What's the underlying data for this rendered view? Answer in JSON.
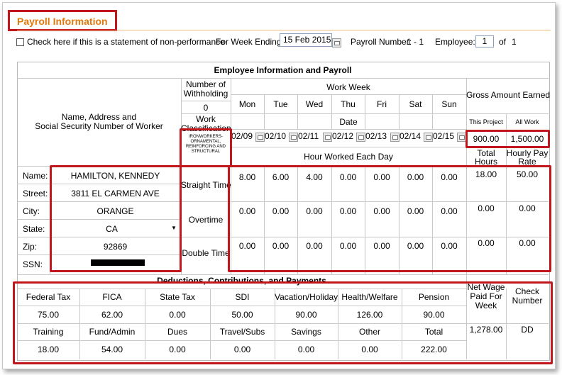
{
  "panel": {
    "title": "Payroll Information"
  },
  "topbar": {
    "non_performance_label": "Check here if this is a statement of non-performance",
    "week_ending_label": "For Week Ending:",
    "week_ending_value": "15 Feb 2015",
    "payroll_number_label": "Payroll Number:",
    "payroll_number_value": "1 - 1",
    "employee_label": "Employee:",
    "employee_value": "1",
    "employee_of": "of",
    "employee_total": "1"
  },
  "section_title": "Employee Information and Payroll",
  "headers": {
    "name_address_line1": "Name, Address and",
    "name_address_line2": "Social Security Number of Worker",
    "withholding_line1": "Number of",
    "withholding_line2": "Withholding",
    "withholding_value": "0",
    "classification_line1": "Work",
    "classification_line2": "Classification",
    "classification_value_1": "IRONWORKERS-",
    "classification_value_2": "ORNAMENTAL,",
    "classification_value_3": "REINFORCING AND",
    "classification_value_4": "STRUCTURAL",
    "work_week": "Work Week",
    "date": "Date",
    "hours_each_day": "Hour Worked Each Day",
    "gross_amount": "Gross Amount Earned",
    "this_project": "This Project",
    "all_work": "All Work",
    "total_hours_1": "Total",
    "total_hours_2": "Hours",
    "hourly_rate_1": "Hourly Pay",
    "hourly_rate_2": "Rate"
  },
  "days": [
    "Mon",
    "Tue",
    "Wed",
    "Thu",
    "Fri",
    "Sat",
    "Sun"
  ],
  "dates": [
    "02/09",
    "02/10",
    "02/11",
    "02/12",
    "02/13",
    "02/14",
    "02/15"
  ],
  "gross": {
    "this_project": "900.00",
    "all_work": "1,500.00"
  },
  "worker": {
    "name_label": "Name:",
    "name": "HAMILTON, KENNEDY",
    "street_label": "Street:",
    "street": "3811 EL CARMEN AVE",
    "city_label": "City:",
    "city": "ORANGE",
    "state_label": "State:",
    "state": "CA",
    "zip_label": "Zip:",
    "zip": "92869",
    "ssn_label": "SSN:"
  },
  "hours": {
    "straight_label": "Straight Time",
    "overtime_label": "Overtime",
    "double_label": "Double Time",
    "straight": [
      "8.00",
      "6.00",
      "4.00",
      "0.00",
      "0.00",
      "0.00",
      "0.00"
    ],
    "overtime": [
      "0.00",
      "0.00",
      "0.00",
      "0.00",
      "0.00",
      "0.00",
      "0.00"
    ],
    "double": [
      "0.00",
      "0.00",
      "0.00",
      "0.00",
      "0.00",
      "0.00",
      "0.00"
    ],
    "straight_total": "18.00",
    "straight_rate": "50.00",
    "overtime_total": "0.00",
    "overtime_rate": "0.00",
    "double_total": "0.00",
    "double_rate": "0.00"
  },
  "deductions": {
    "section_title": "Deductions, Contributions, and Payments",
    "row1_labels": [
      "Federal Tax",
      "FICA",
      "State Tax",
      "SDI",
      "Vacation/Holiday",
      "Health/Welfare",
      "Pension"
    ],
    "row1_values": [
      "75.00",
      "62.00",
      "0.00",
      "50.00",
      "90.00",
      "126.00",
      "90.00"
    ],
    "row2_labels": [
      "Training",
      "Fund/Admin",
      "Dues",
      "Travel/Subs",
      "Savings",
      "Other",
      "Total"
    ],
    "row2_values": [
      "18.00",
      "54.00",
      "0.00",
      "0.00",
      "0.00",
      "0.00",
      "222.00"
    ],
    "net_wage_1": "Net Wage",
    "net_wage_2": "Paid For",
    "net_wage_3": "Week",
    "net_wage_value": "1,278.00",
    "check_1": "Check",
    "check_2": "Number",
    "check_value": "DD"
  }
}
